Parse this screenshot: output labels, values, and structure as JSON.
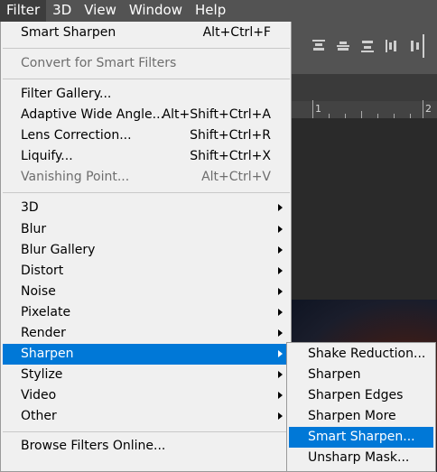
{
  "menubar": {
    "items": [
      "Filter",
      "3D",
      "View",
      "Window",
      "Help"
    ]
  },
  "ruler": {
    "labels": [
      "1",
      "2"
    ]
  },
  "filter_menu": {
    "last_filter": {
      "label": "Smart Sharpen",
      "shortcut": "Alt+Ctrl+F"
    },
    "convert_smart": {
      "label": "Convert for Smart Filters"
    },
    "filter_gallery": {
      "label": "Filter Gallery..."
    },
    "adaptive_wide_angle": {
      "label": "Adaptive Wide Angle...",
      "shortcut": "Alt+Shift+Ctrl+A"
    },
    "lens_correction": {
      "label": "Lens Correction...",
      "shortcut": "Shift+Ctrl+R"
    },
    "liquify": {
      "label": "Liquify...",
      "shortcut": "Shift+Ctrl+X"
    },
    "vanishing_point": {
      "label": "Vanishing Point...",
      "shortcut": "Alt+Ctrl+V"
    },
    "categories": [
      "3D",
      "Blur",
      "Blur Gallery",
      "Distort",
      "Noise",
      "Pixelate",
      "Render",
      "Sharpen",
      "Stylize",
      "Video",
      "Other"
    ],
    "browse_online": {
      "label": "Browse Filters Online..."
    }
  },
  "sharpen_submenu": {
    "items": [
      "Shake Reduction...",
      "Sharpen",
      "Sharpen Edges",
      "Sharpen More",
      "Smart Sharpen...",
      "Unsharp Mask..."
    ]
  },
  "colors": {
    "highlight": "#0078d7",
    "menu_bg": "#f0f0f0",
    "menubar_bg": "#535353"
  }
}
